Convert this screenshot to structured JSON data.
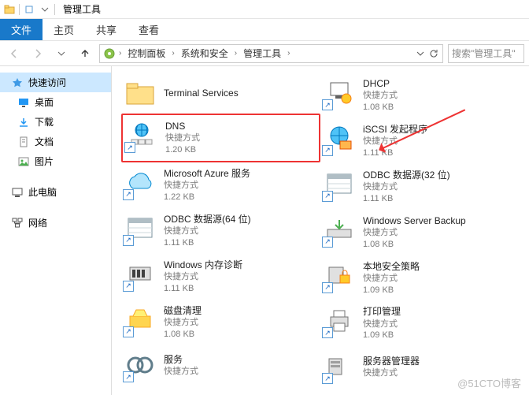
{
  "window": {
    "title": "管理工具"
  },
  "ribbon": {
    "file": "文件",
    "home": "主页",
    "share": "共享",
    "view": "查看"
  },
  "breadcrumb": {
    "cp": "控制面板",
    "sys": "系统和安全",
    "tools": "管理工具"
  },
  "search": {
    "placeholder": "搜索\"管理工具\""
  },
  "sidebar": {
    "quick": "快速访问",
    "desktop": "桌面",
    "downloads": "下载",
    "documents": "文档",
    "pictures": "图片",
    "thispc": "此电脑",
    "network": "网络"
  },
  "items": {
    "terminal": {
      "name": "Terminal Services"
    },
    "dns": {
      "name": "DNS",
      "type": "快捷方式",
      "size": "1.20 KB"
    },
    "azure": {
      "name": "Microsoft Azure 服务",
      "type": "快捷方式",
      "size": "1.22 KB"
    },
    "odbc64": {
      "name": "ODBC 数据源(64 位)",
      "type": "快捷方式",
      "size": "1.11 KB"
    },
    "memdiag": {
      "name": "Windows 内存诊断",
      "type": "快捷方式",
      "size": "1.11 KB"
    },
    "diskclean": {
      "name": "磁盘清理",
      "type": "快捷方式",
      "size": "1.08 KB"
    },
    "services": {
      "name": "服务",
      "type": "快捷方式"
    },
    "dhcp": {
      "name": "DHCP",
      "type": "快捷方式",
      "size": "1.08 KB"
    },
    "iscsi": {
      "name": "iSCSI 发起程序",
      "type": "快捷方式",
      "size": "1.11 KB"
    },
    "odbc32": {
      "name": "ODBC 数据源(32 位)",
      "type": "快捷方式",
      "size": "1.11 KB"
    },
    "wsbackup": {
      "name": "Windows Server Backup",
      "type": "快捷方式",
      "size": "1.08 KB"
    },
    "secpol": {
      "name": "本地安全策略",
      "type": "快捷方式",
      "size": "1.09 KB"
    },
    "print": {
      "name": "打印管理",
      "type": "快捷方式",
      "size": "1.09 KB"
    },
    "srvmgr": {
      "name": "服务器管理器",
      "type": "快捷方式"
    }
  },
  "watermark": "@51CTO博客"
}
